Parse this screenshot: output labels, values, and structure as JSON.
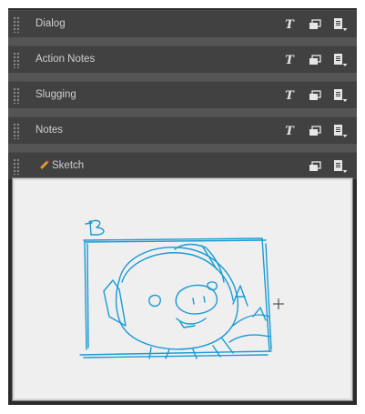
{
  "panel": {
    "rows": [
      {
        "label": "Dialog",
        "tools": [
          "text-tool",
          "copy-tool",
          "menu-tool"
        ]
      },
      {
        "label": "Action Notes",
        "tools": [
          "text-tool",
          "copy-tool",
          "menu-tool"
        ]
      },
      {
        "label": "Slugging",
        "tools": [
          "text-tool",
          "copy-tool",
          "menu-tool"
        ]
      },
      {
        "label": "Notes",
        "tools": [
          "text-tool",
          "copy-tool",
          "menu-tool"
        ]
      },
      {
        "label": "Sketch",
        "icon": "pencil-icon",
        "tools": [
          "copy-tool",
          "menu-tool"
        ]
      }
    ],
    "text_tool_glyph": "T"
  },
  "sketch": {
    "stroke_color": "#1a9ad6",
    "background": "#efefef",
    "scene": "pig face drawing in a frame",
    "letters": [
      "B",
      "A"
    ],
    "cursor": "crosshair-cursor-icon"
  }
}
